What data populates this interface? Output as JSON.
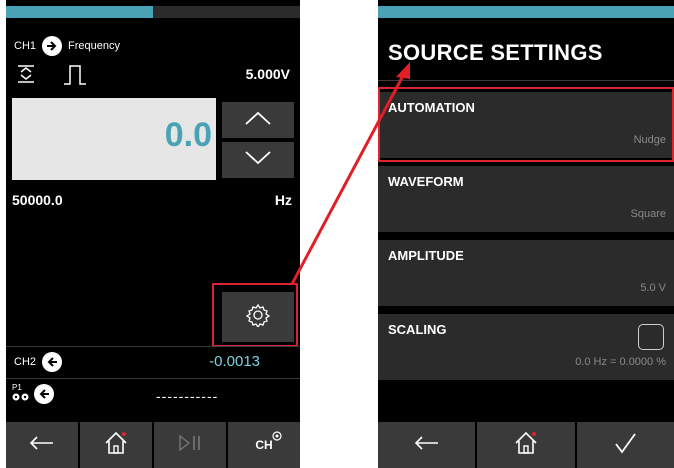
{
  "left_screen": {
    "progress_fraction": 0.5,
    "channel1": {
      "label": "CH1",
      "mode": "Frequency"
    },
    "voltage": "5.000V",
    "main_value": "0.0",
    "frequency_value": "50000.0",
    "frequency_unit": "Hz",
    "channel2": {
      "label": "CH2",
      "value": "-0.0013"
    },
    "p1": {
      "label": "P1",
      "value": "-----------"
    },
    "bottom_bar": {
      "back_icon": "arrow-left-icon",
      "home_icon": "home-icon",
      "play_pause_icon": "play-pause-icon",
      "channel_icon": "channel-settings-icon",
      "channel_icon_text": "CH"
    }
  },
  "right_screen": {
    "title": "SOURCE SETTINGS",
    "settings": [
      {
        "label": "AUTOMATION",
        "value": "Nudge"
      },
      {
        "label": "WAVEFORM",
        "value": "Square"
      },
      {
        "label": "AMPLITUDE",
        "value": "5.0 V"
      },
      {
        "label": "SCALING",
        "value": "0.0 Hz = 0.0000 %",
        "checked": false
      }
    ],
    "bottom_bar": {
      "back_icon": "arrow-left-icon",
      "home_icon": "home-icon",
      "confirm_icon": "checkmark-icon"
    }
  },
  "colors": {
    "accent": "#4aa3b5",
    "highlight": "#d9252f",
    "panel": "#3a3a3a"
  }
}
